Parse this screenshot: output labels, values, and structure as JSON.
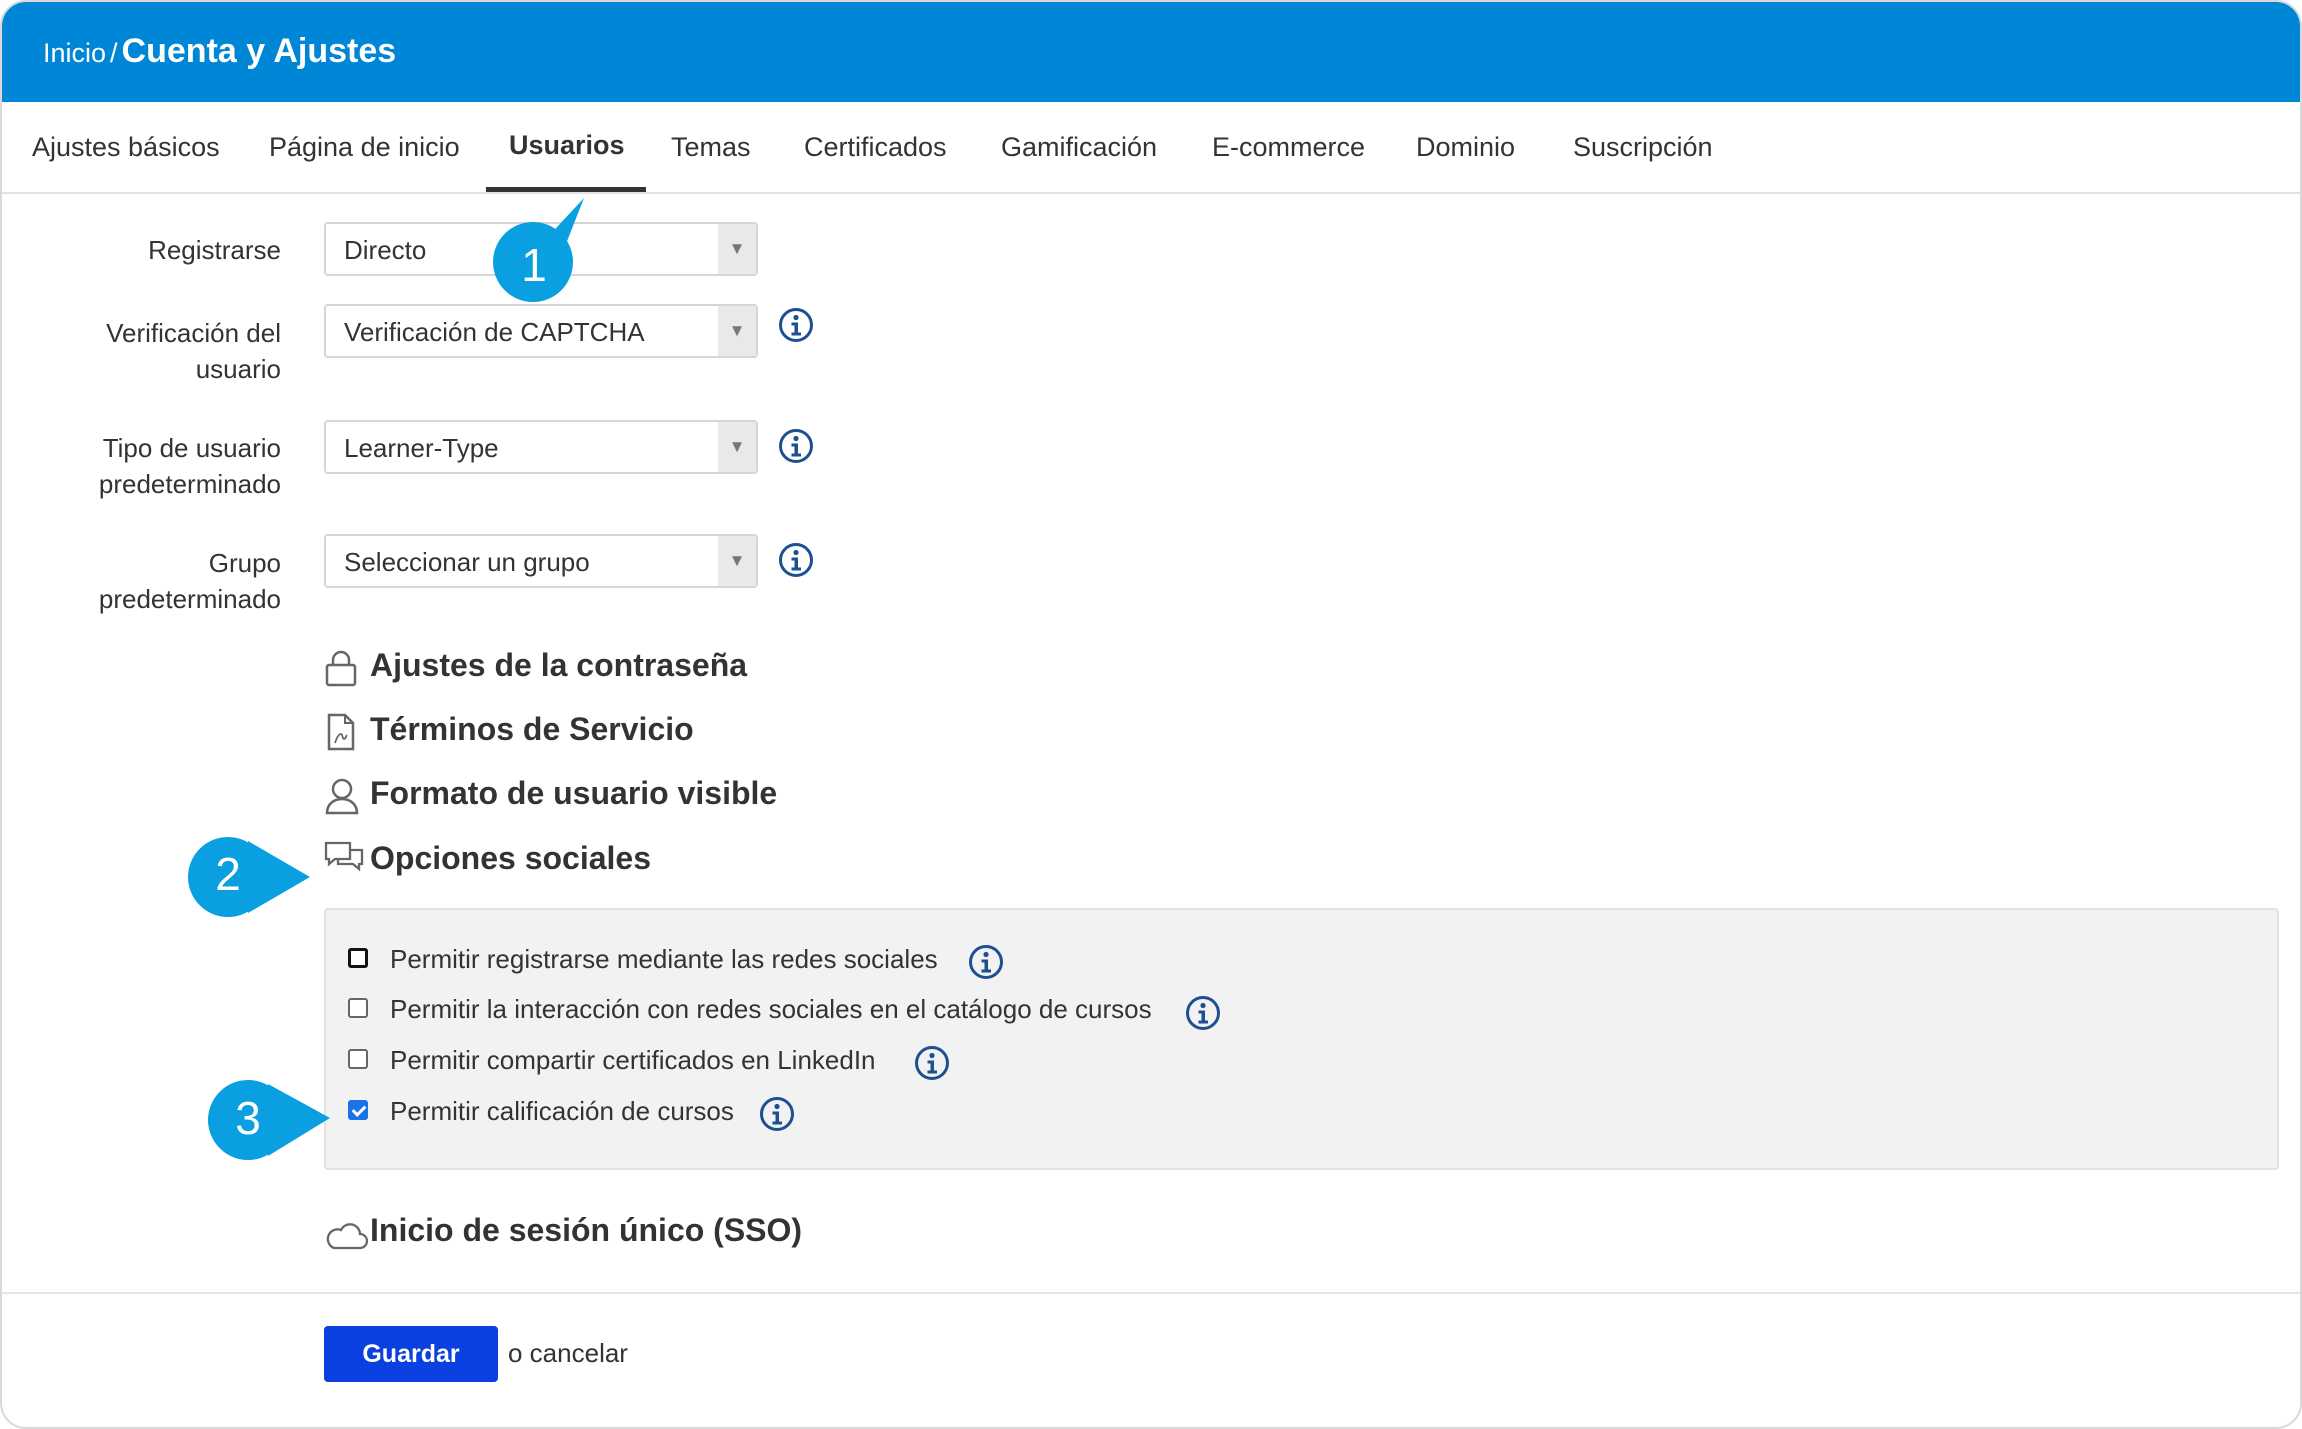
{
  "breadcrumb": {
    "home": "Inicio",
    "separator": "/",
    "current": "Cuenta y Ajustes"
  },
  "tabs": [
    {
      "label": "Ajustes básicos"
    },
    {
      "label": "Página de inicio"
    },
    {
      "label": "Usuarios",
      "active": true
    },
    {
      "label": "Temas"
    },
    {
      "label": "Certificados"
    },
    {
      "label": "Gamificación"
    },
    {
      "label": "E-commerce"
    },
    {
      "label": "Dominio"
    },
    {
      "label": "Suscripción"
    }
  ],
  "form": {
    "registrarse": {
      "label": "Registrarse",
      "value": "Directo"
    },
    "verificacion": {
      "label_line1": "Verificación del",
      "label_line2": "usuario",
      "value": "Verificación de CAPTCHA"
    },
    "tipo_usuario": {
      "label_line1": "Tipo de usuario",
      "label_line2": "predeterminado",
      "value": "Learner-Type"
    },
    "grupo": {
      "label_line1": "Grupo",
      "label_line2": "predeterminado",
      "value": "Seleccionar un grupo"
    }
  },
  "sections": {
    "password": "Ajustes de la contraseña",
    "terms": "Términos de Servicio",
    "user_format": "Formato de usuario visible",
    "social": "Opciones sociales",
    "sso": "Inicio de sesión único (SSO)"
  },
  "social_options": [
    {
      "label": "Permitir registrarse mediante las redes sociales",
      "checked": false
    },
    {
      "label": "Permitir la interacción con redes sociales en el catálogo de cursos",
      "checked": false
    },
    {
      "label": "Permitir compartir certificados en LinkedIn",
      "checked": false
    },
    {
      "label": "Permitir calificación de cursos",
      "checked": true
    }
  ],
  "footer": {
    "save_label": "Guardar",
    "cancel_text": "o cancelar"
  },
  "callouts": {
    "one": "1",
    "two": "2",
    "three": "3"
  },
  "colors": {
    "header": "#0086d6",
    "callout": "#0a9fe0",
    "save": "#0a3fe0",
    "info_icon": "#1d4f91"
  }
}
